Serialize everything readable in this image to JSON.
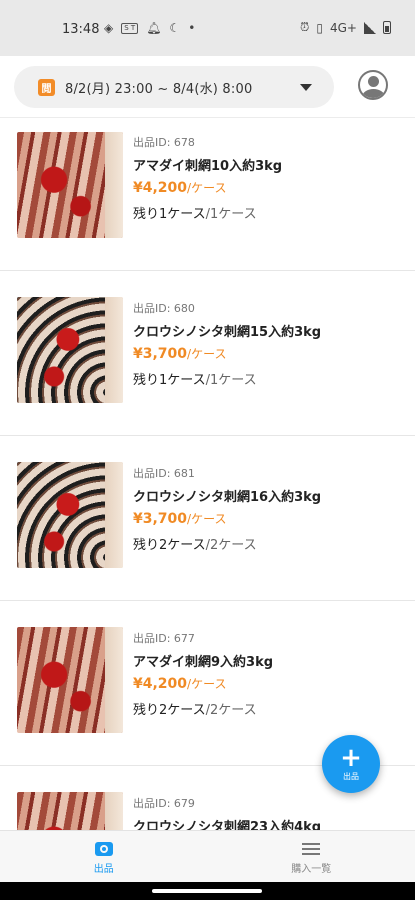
{
  "status_bar": {
    "time": "13:48",
    "badge_text": "SURE\nTRADE",
    "network": "4G+",
    "icons_left": [
      "sync-icon",
      "badge-icon",
      "bell-icon",
      "moon-icon",
      "dot-icon"
    ],
    "icons_right": [
      "alarm-icon",
      "vibrate-icon",
      "network-4g",
      "signal-icon",
      "battery-icon"
    ]
  },
  "header": {
    "calendar_icon_text": "閲",
    "period": "8/2(月) 23:00 ~ 8/4(水) 8:00"
  },
  "items": [
    {
      "id_label": "出品ID: 678",
      "name": "アマダイ刺網10入約3kg",
      "price": "¥4,200",
      "price_unit": "/ケース",
      "remaining": "残り1ケース",
      "total": "/1ケース",
      "thumb": "a"
    },
    {
      "id_label": "出品ID: 680",
      "name": "クロウシノシタ刺網15入約3kg",
      "price": "¥3,700",
      "price_unit": "/ケース",
      "remaining": "残り1ケース",
      "total": "/1ケース",
      "thumb": "b"
    },
    {
      "id_label": "出品ID: 681",
      "name": "クロウシノシタ刺網16入約3kg",
      "price": "¥3,700",
      "price_unit": "/ケース",
      "remaining": "残り2ケース",
      "total": "/2ケース",
      "thumb": "b"
    },
    {
      "id_label": "出品ID: 677",
      "name": "アマダイ刺網9入約3kg",
      "price": "¥4,200",
      "price_unit": "/ケース",
      "remaining": "残り2ケース",
      "total": "/2ケース",
      "thumb": "a"
    },
    {
      "id_label": "出品ID: 679",
      "name": "クロウシノシタ刺網23入約4kg",
      "price": "",
      "price_unit": "",
      "remaining": "",
      "total": "",
      "thumb": "a"
    }
  ],
  "fab": {
    "label": "出品"
  },
  "bottom_nav": {
    "tabs": [
      {
        "label": "出品",
        "icon": "camera-icon",
        "active": true
      },
      {
        "label": "購入一覧",
        "icon": "list-icon",
        "active": false
      }
    ]
  },
  "colors": {
    "accent": "#1a9af0",
    "price": "#f08a24",
    "calendar": "#f28c28"
  }
}
